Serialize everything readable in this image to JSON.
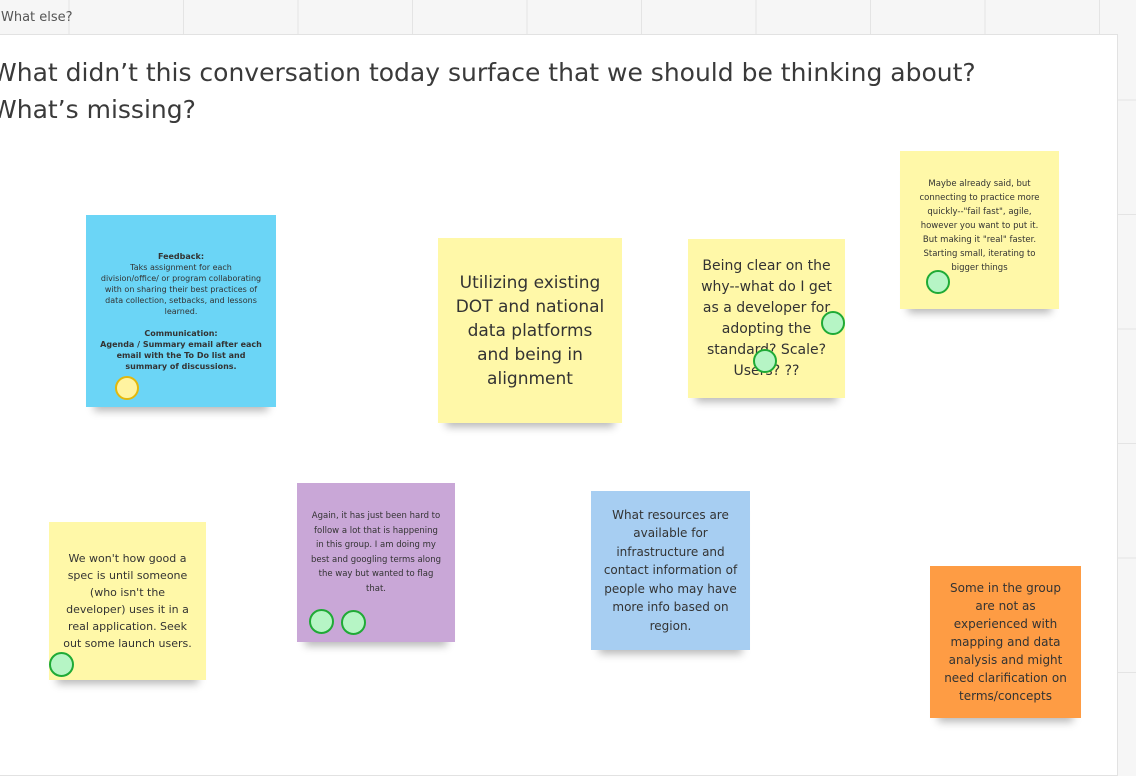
{
  "frame": {
    "label": "What else?",
    "heading": "What didn’t this conversation today surface that we should be thinking about? What’s missing?"
  },
  "notes": {
    "feedback": {
      "text": "Taks assignment for each division/office/ or program collaborating with on sharing their best practices of data collection, setbacks, and lessons learned.",
      "bold_title": "Feedback:",
      "comm_title": "Communication:",
      "comm_text": "Agenda / Summary email after each email with the To Do list and summary of discussions."
    },
    "platforms": {
      "text": "Utilizing existing DOT and national data platforms and being in alignment"
    },
    "why": {
      "text": "Being clear on the why--what do I get as a developer for adopting the standard? Scale? Users? ??"
    },
    "fail_fast": {
      "text": "Maybe already said, but connecting to practice more quickly--\"fail fast\", agile, however you want to put it. But making it \"real\" faster. Starting small, iterating to bigger things"
    },
    "spec": {
      "text": "We won't how good a spec is until someone (who isn't the developer) uses it in a real application.  Seek out some launch users."
    },
    "hard_follow": {
      "text": "Again, it has just been hard to follow a lot that is happening in this group. I am doing my best and googling terms along the way but wanted to flag that."
    },
    "resources": {
      "text": "What resources are available for infrastructure and contact information of people who may have more info based on region."
    },
    "experience": {
      "text": "Some in the group are not as experienced with mapping and data analysis and might need clarification on terms/concepts"
    }
  },
  "colors": {
    "blue": "#6bd5f6",
    "yellow": "#fff8a8",
    "purple": "#c9a7d7",
    "lightblue": "#a7cef2",
    "orange": "#fe9c44",
    "vote_dot": "#b6f5c5"
  }
}
